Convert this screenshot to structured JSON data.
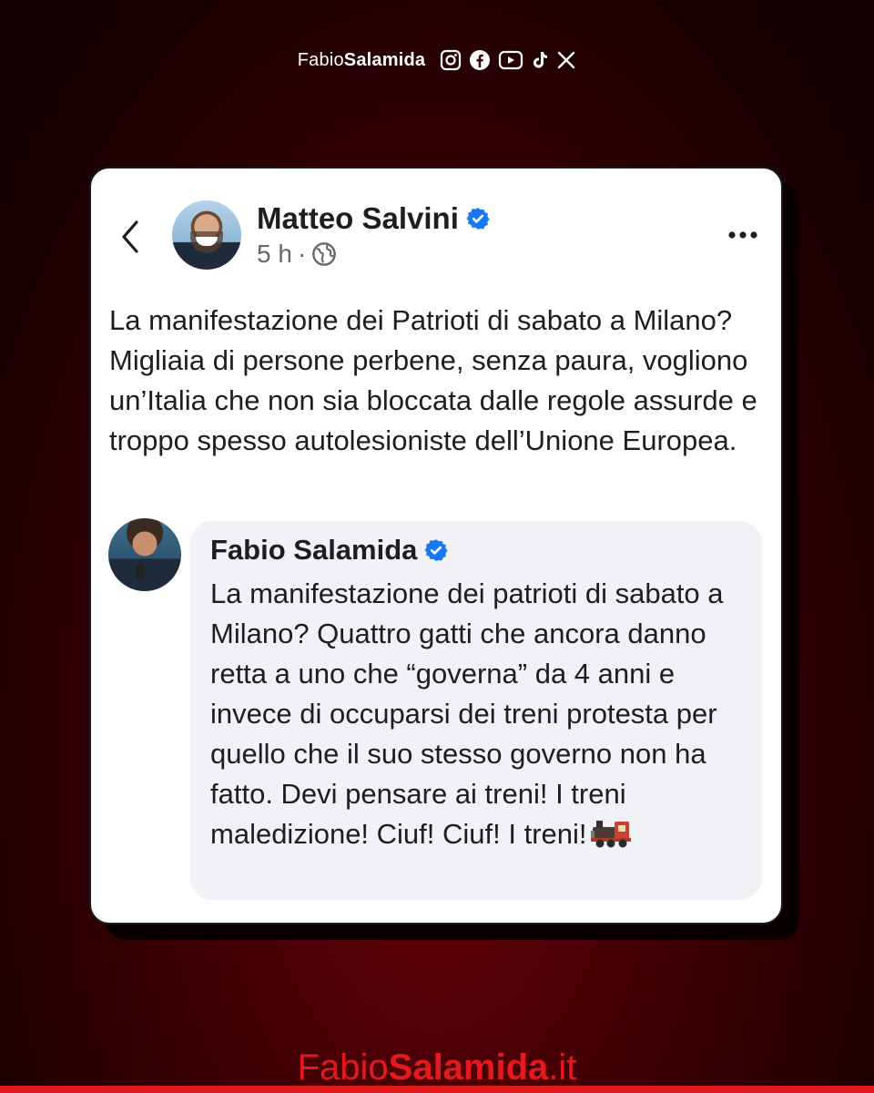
{
  "header": {
    "brand_part1": "Fabio",
    "brand_part2": "Salamida",
    "social_icons": [
      "instagram-icon",
      "facebook-icon",
      "youtube-icon",
      "tiktok-icon",
      "x-icon"
    ]
  },
  "post": {
    "author": "Matteo Salvini",
    "verified": true,
    "time": "5 h",
    "separator": "·",
    "audience_icon": "globe-icon",
    "text": "La manifestazione dei Patrioti di sabato a Milano? Migliaia di persone perbene, senza paura, vogliono un’Italia che non sia bloccata dalle regole assurde e troppo spesso autolesioniste dell’Unione Europea."
  },
  "comment": {
    "author": "Fabio Salamida",
    "verified": true,
    "text": "La manifestazione dei patrioti di sabato a Milano? Quattro gatti che ancora danno retta a uno che “governa” da 4 anni e invece di occuparsi dei treni protesta per quello che il suo stesso governo non ha fatto. Devi pensare ai treni! I treni maledizione! Ciuf! Ciuf! I treni!",
    "emoji": "train-icon"
  },
  "footer": {
    "part1": "Fabio",
    "part2": "Salamida",
    "part3": ".it"
  },
  "colors": {
    "accent_red": "#e01a1f",
    "verified_blue": "#1877f2",
    "background_dark": "#1a0002"
  }
}
